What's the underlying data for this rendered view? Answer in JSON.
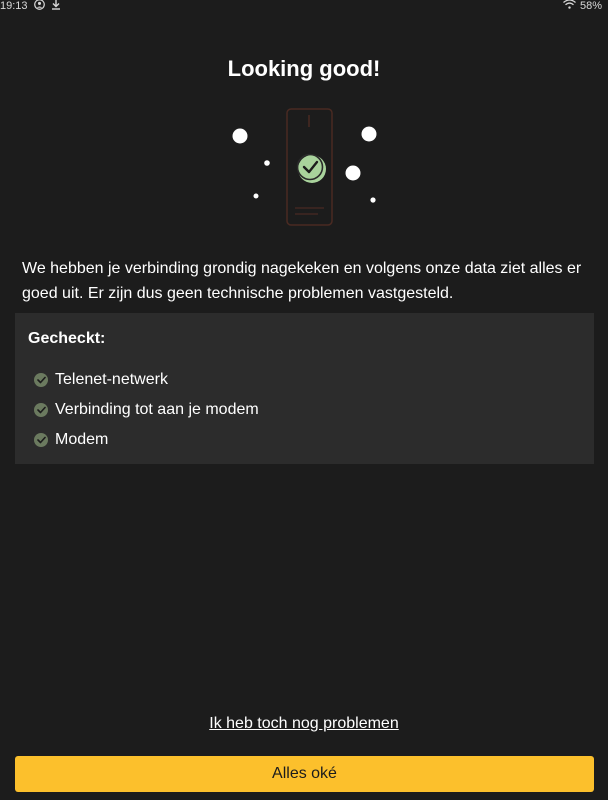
{
  "status_bar": {
    "time": "19:13",
    "battery": "58%"
  },
  "header": {
    "title": "Looking good!"
  },
  "main": {
    "description": "We hebben je verbinding grondig nagekeken en volgens onze data ziet alles er goed uit. Er zijn dus geen technische problemen vastgesteld.",
    "checked": {
      "title": "Gecheckt:",
      "items": [
        {
          "label": "Telenet-netwerk"
        },
        {
          "label": "Verbinding tot aan je modem"
        },
        {
          "label": "Modem"
        }
      ]
    }
  },
  "footer": {
    "problem_link": "Ik heb toch nog problemen",
    "ok_button": "Alles oké"
  },
  "colors": {
    "background": "#1c1c1c",
    "card": "#2c2c2c",
    "accent": "#fcc02c",
    "check": "#6b7a5f",
    "illustration_check": "#a9d39c"
  },
  "icons": [
    "account-circle-icon",
    "download-icon",
    "wifi-icon",
    "battery-icon",
    "check-icon",
    "modem-icon"
  ]
}
